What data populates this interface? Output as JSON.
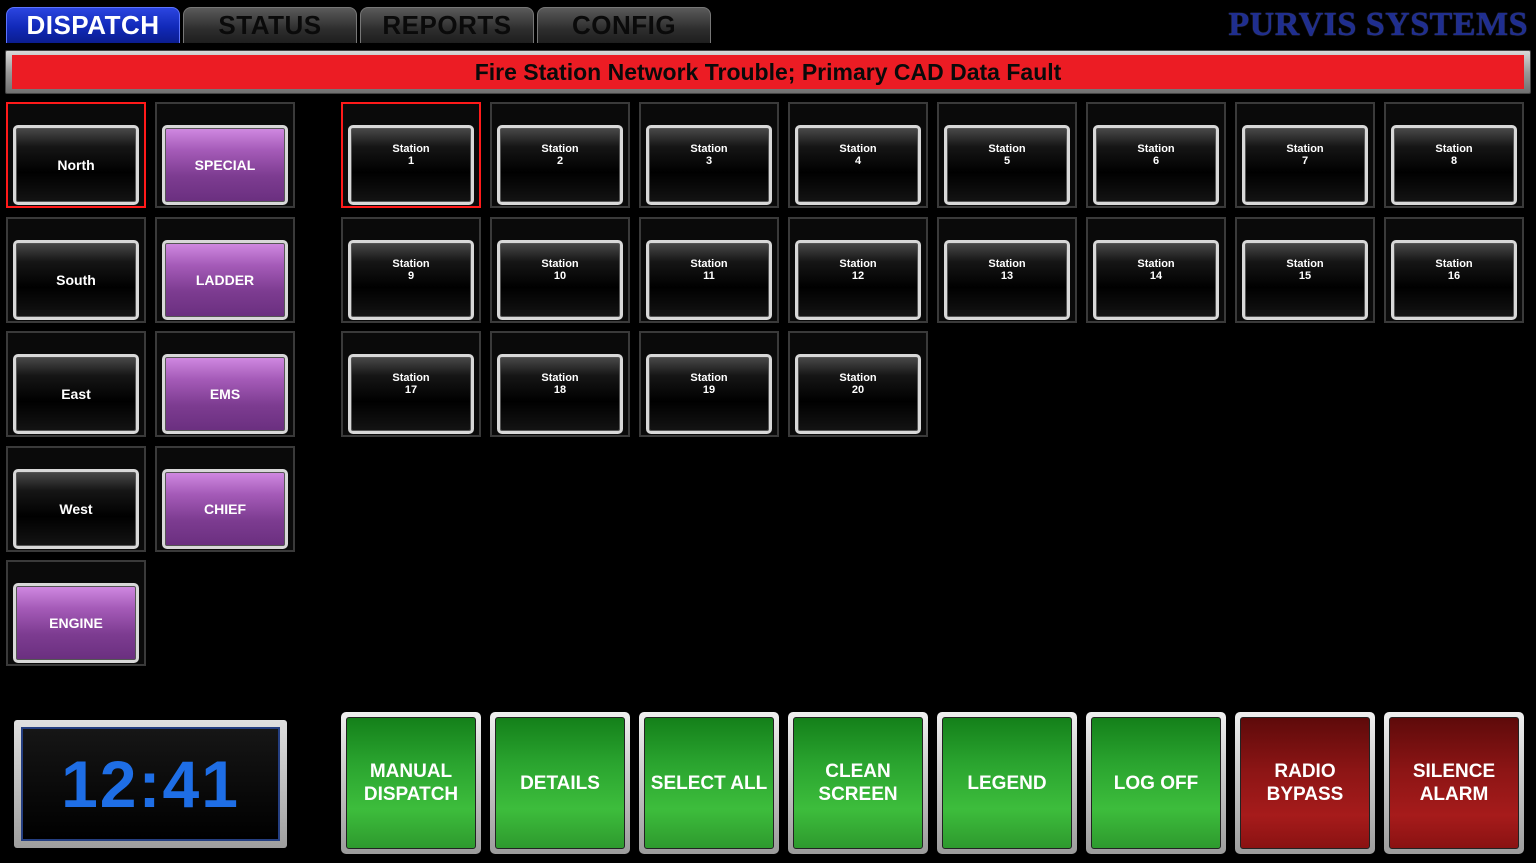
{
  "tabs": [
    {
      "label": "DISPATCH",
      "active": true
    },
    {
      "label": "STATUS",
      "active": false
    },
    {
      "label": "REPORTS",
      "active": false
    },
    {
      "label": "CONFIG",
      "active": false
    }
  ],
  "brand": "PURVIS SYSTEMS",
  "alert": {
    "message": "Fire Station Network Trouble; Primary CAD Data Fault",
    "color": "#ec1c24"
  },
  "zones": [
    {
      "label": "North",
      "selected": true
    },
    {
      "label": "South",
      "selected": false
    },
    {
      "label": "East",
      "selected": false
    },
    {
      "label": "West",
      "selected": false
    }
  ],
  "unit_types": [
    {
      "label": "SPECIAL"
    },
    {
      "label": "LADDER"
    },
    {
      "label": "EMS"
    },
    {
      "label": "CHIEF"
    },
    {
      "label": "ENGINE"
    }
  ],
  "stations": [
    {
      "label": "Station",
      "number": "1",
      "selected": true
    },
    {
      "label": "Station",
      "number": "2",
      "selected": false
    },
    {
      "label": "Station",
      "number": "3",
      "selected": false
    },
    {
      "label": "Station",
      "number": "4",
      "selected": false
    },
    {
      "label": "Station",
      "number": "5",
      "selected": false
    },
    {
      "label": "Station",
      "number": "6",
      "selected": false
    },
    {
      "label": "Station",
      "number": "7",
      "selected": false
    },
    {
      "label": "Station",
      "number": "8",
      "selected": false
    },
    {
      "label": "Station",
      "number": "9",
      "selected": false
    },
    {
      "label": "Station",
      "number": "10",
      "selected": false
    },
    {
      "label": "Station",
      "number": "11",
      "selected": false
    },
    {
      "label": "Station",
      "number": "12",
      "selected": false
    },
    {
      "label": "Station",
      "number": "13",
      "selected": false
    },
    {
      "label": "Station",
      "number": "14",
      "selected": false
    },
    {
      "label": "Station",
      "number": "15",
      "selected": false
    },
    {
      "label": "Station",
      "number": "16",
      "selected": false
    },
    {
      "label": "Station",
      "number": "17",
      "selected": false
    },
    {
      "label": "Station",
      "number": "18",
      "selected": false
    },
    {
      "label": "Station",
      "number": "19",
      "selected": false
    },
    {
      "label": "Station",
      "number": "20",
      "selected": false
    }
  ],
  "clock": {
    "time": "12:41"
  },
  "actions": [
    {
      "label": "MANUAL DISPATCH",
      "color": "green"
    },
    {
      "label": "DETAILS",
      "color": "green"
    },
    {
      "label": "SELECT ALL",
      "color": "green"
    },
    {
      "label": "CLEAN SCREEN",
      "color": "green"
    },
    {
      "label": "LEGEND",
      "color": "green"
    },
    {
      "label": "LOG OFF",
      "color": "green"
    },
    {
      "label": "RADIO BYPASS",
      "color": "red"
    },
    {
      "label": "SILENCE ALARM",
      "color": "red"
    }
  ]
}
